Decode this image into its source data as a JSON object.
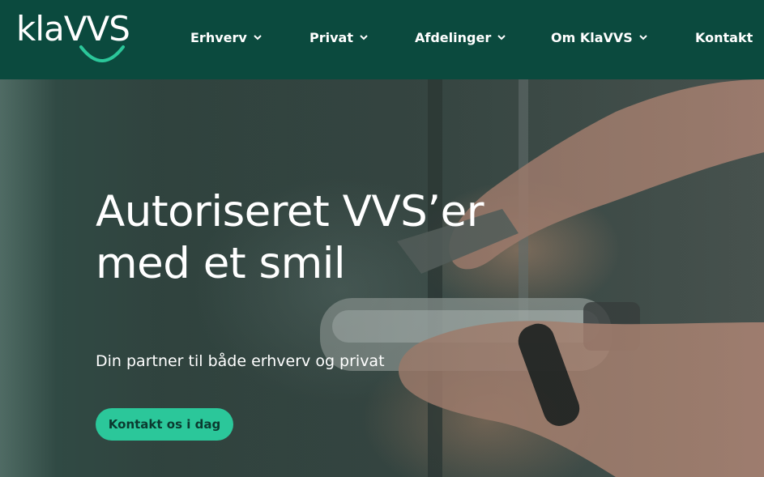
{
  "brand": {
    "logo_text": "klaVVS"
  },
  "nav": {
    "items": [
      {
        "label": "Erhverv",
        "has_dropdown": true
      },
      {
        "label": "Privat",
        "has_dropdown": true
      },
      {
        "label": "Afdelinger",
        "has_dropdown": true
      },
      {
        "label": "Om KlaVVS",
        "has_dropdown": true
      },
      {
        "label": "Kontakt",
        "has_dropdown": false
      }
    ]
  },
  "hero": {
    "title_line1": "Autoriseret VVS’er",
    "title_line2": "med et smil",
    "subtitle": "Din partner til både erhverv og privat",
    "cta_label": "Kontakt os i dag",
    "image_icon": "plumber-hands-wrench-image"
  },
  "colors": {
    "header_bg": "#0b4a3e",
    "accent": "#2bc79a",
    "text": "#ffffff"
  }
}
